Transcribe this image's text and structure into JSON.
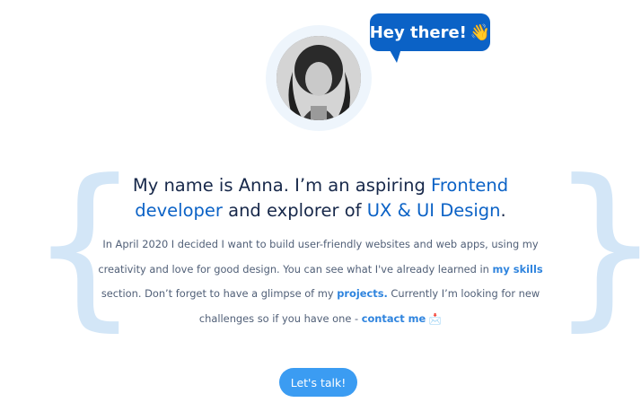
{
  "avatar": {
    "alt": "Anna"
  },
  "greeting": {
    "text": "Hey there!",
    "emoji": "👋"
  },
  "headline": {
    "part1": "My name is Anna. I’m an aspiring ",
    "highlight1": "Frontend developer",
    "part2": " and explorer of ",
    "highlight2": "UX & UI Design",
    "part3": "."
  },
  "bio": {
    "part1": "In April 2020 I decided I want to build user-friendly websites and web apps, using my creativity and love for good design. You can see what I've already learned in ",
    "link_skills": "my skills",
    "part2": " section. Don’t forget to have a glimpse of my ",
    "link_projects": "projects.",
    "part3": " Currently I’m looking for new challenges so if you have one - ",
    "link_contact": "contact me",
    "contact_emoji": "📩"
  },
  "cta": {
    "label": "Let's talk!"
  },
  "braces": {
    "left": "{",
    "right": "}"
  },
  "colors": {
    "brand": "#0b62c6",
    "link": "#2f84de",
    "button": "#3b9cf2",
    "brace": "#d3e6f7",
    "heading_text": "#17284a",
    "body_text": "#505f77"
  }
}
